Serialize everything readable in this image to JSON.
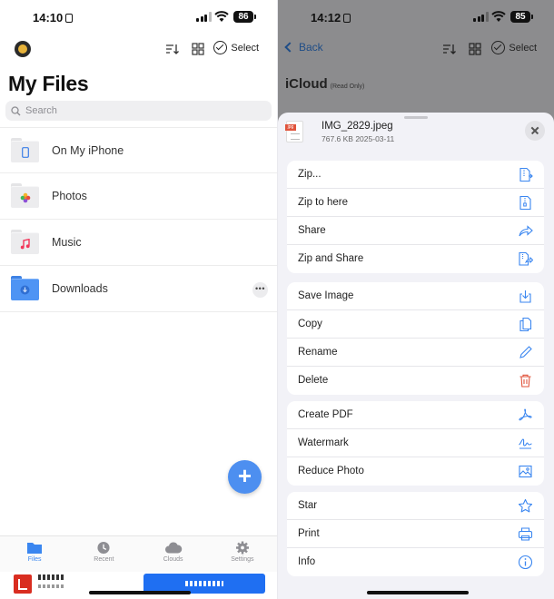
{
  "left": {
    "status": {
      "time": "14:10",
      "battery": "86"
    },
    "toolbar": {
      "select_label": "Select"
    },
    "title": "My Files",
    "search_placeholder": "Search",
    "files": [
      {
        "name": "On My iPhone"
      },
      {
        "name": "Photos"
      },
      {
        "name": "Music"
      },
      {
        "name": "Downloads"
      }
    ],
    "tabs": [
      {
        "label": "Files",
        "active": true
      },
      {
        "label": "Recent"
      },
      {
        "label": "Clouds"
      },
      {
        "label": "Settings"
      }
    ]
  },
  "right": {
    "status": {
      "time": "14:12",
      "battery": "85"
    },
    "back_label": "Back",
    "select_label": "Select",
    "location_title": "iCloud",
    "location_sub": "(Read Only)",
    "sheet": {
      "file_name": "IMG_2829.jpeg",
      "file_meta": "767.6 KB 2025-03-11",
      "file_icon_label": "jpg",
      "groups": [
        [
          {
            "label": "Zip...",
            "icon": "zip-icon"
          },
          {
            "label": "Zip to here",
            "icon": "zip-here-icon"
          },
          {
            "label": "Share",
            "icon": "share-icon"
          },
          {
            "label": "Zip and Share",
            "icon": "zip-share-icon"
          }
        ],
        [
          {
            "label": "Save Image",
            "icon": "save-image-icon"
          },
          {
            "label": "Copy",
            "icon": "copy-icon"
          },
          {
            "label": "Rename",
            "icon": "rename-icon"
          },
          {
            "label": "Delete",
            "icon": "trash-icon"
          }
        ],
        [
          {
            "label": "Create PDF",
            "icon": "pdf-icon"
          },
          {
            "label": "Watermark",
            "icon": "watermark-icon"
          },
          {
            "label": "Reduce Photo",
            "icon": "reduce-photo-icon"
          }
        ],
        [
          {
            "label": "Star",
            "icon": "star-icon"
          },
          {
            "label": "Print",
            "icon": "print-icon"
          },
          {
            "label": "Info",
            "icon": "info-icon"
          }
        ]
      ]
    }
  },
  "colors": {
    "accent": "#3a86f0",
    "delete": "#e0533b",
    "overlay": "#8c8c8e"
  }
}
